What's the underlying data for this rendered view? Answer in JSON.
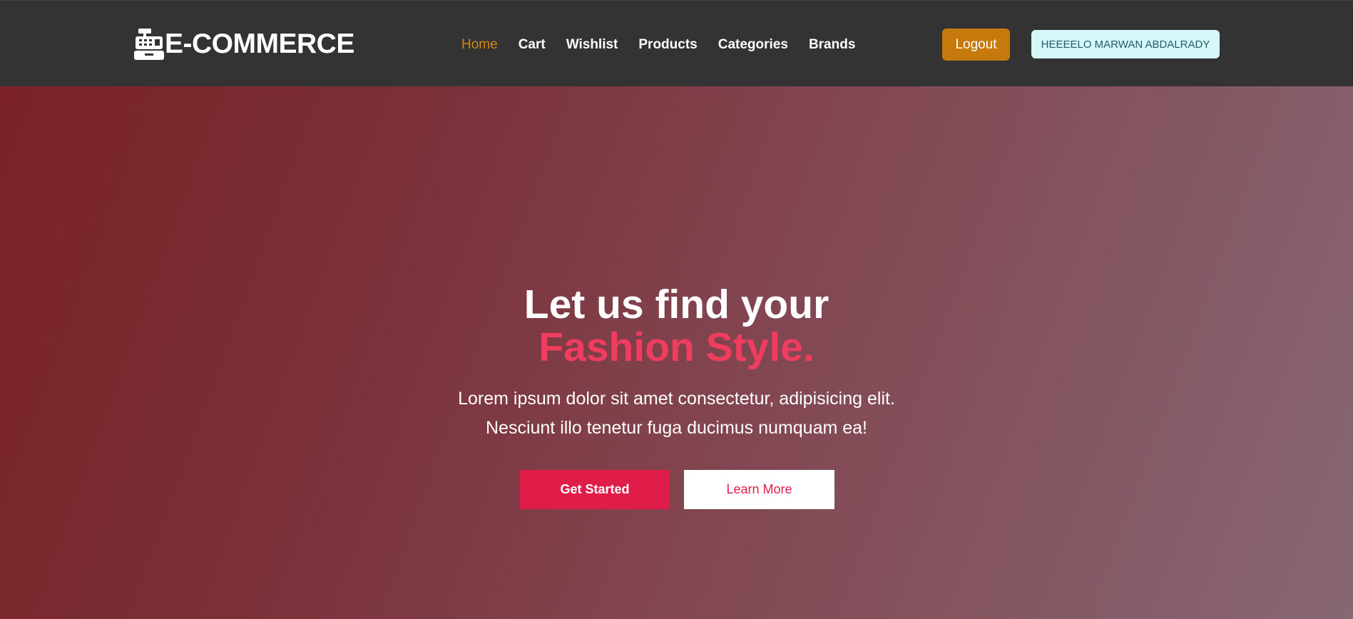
{
  "navbar": {
    "brand": {
      "icon": "cash-register-icon",
      "text": "E-COMMERCE"
    },
    "links": [
      {
        "label": "Home",
        "active": true
      },
      {
        "label": "Cart",
        "active": false
      },
      {
        "label": "Wishlist",
        "active": false
      },
      {
        "label": "Products",
        "active": false
      },
      {
        "label": "Categories",
        "active": false
      },
      {
        "label": "Brands",
        "active": false
      }
    ],
    "logout_label": "Logout",
    "user_greeting": "HEEEELO MARWAN ABDALRADY"
  },
  "hero": {
    "title_line1": "Let us find your",
    "title_line2": "Fashion Style.",
    "subtitle_line1": "Lorem ipsum dolor sit amet consectetur, adipisicing elit.",
    "subtitle_line2": "Nesciunt illo tenetur fuga ducimus numquam ea!",
    "primary_button": "Get Started",
    "secondary_button": "Learn More"
  },
  "colors": {
    "navbar_bg": "#333333",
    "active_link": "#d4870f",
    "logout_bg": "#c77a0c",
    "user_badge_bg": "#d7f8fb",
    "accent": "#f03c5f",
    "primary_button_bg": "#e01d48"
  }
}
